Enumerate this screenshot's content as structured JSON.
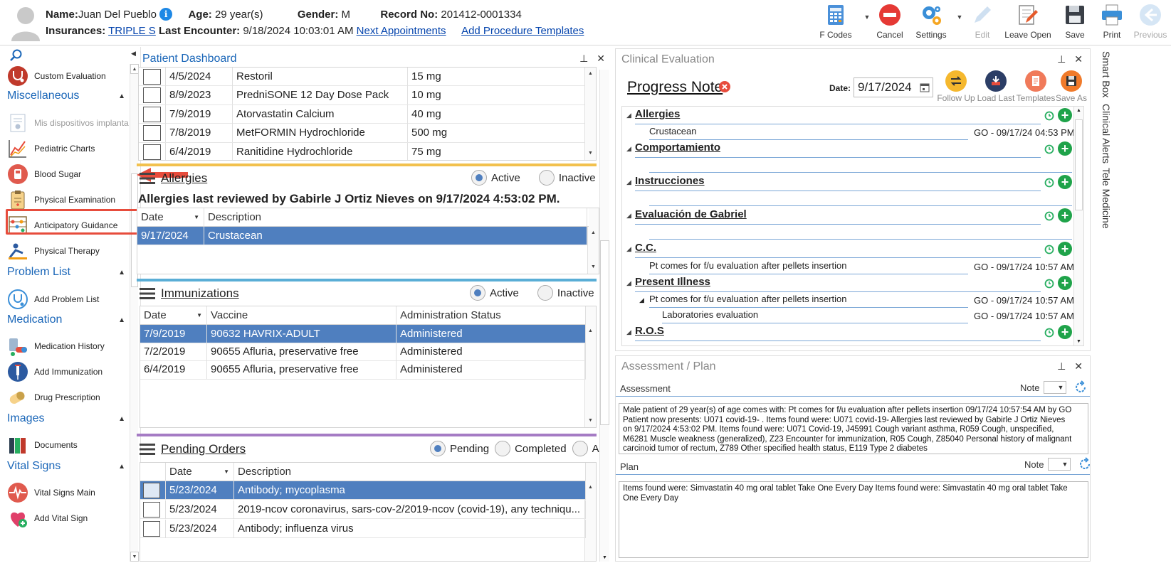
{
  "header": {
    "name_label": "Name:",
    "name": "Juan Del Pueblo",
    "age_label": "Age:",
    "age": "29 year(s)",
    "gender_label": "Gender:",
    "gender": "M",
    "record_label": "Record No:",
    "record": "201412-0001334",
    "insurances_label": "Insurances:",
    "insurance": "TRIPLE S",
    "last_encounter_label": "Last Encounter:",
    "last_encounter": "9/18/2024 10:03:01 AM",
    "next_appointments": "Next Appointments",
    "add_procedure_templates": "Add Procedure Templates",
    "info_glyph": "i"
  },
  "toolbar": {
    "f_codes": "F Codes",
    "cancel": "Cancel",
    "settings": "Settings",
    "edit": "Edit",
    "leave_open": "Leave Open",
    "save": "Save",
    "print": "Print",
    "previous": "Previous"
  },
  "sidebar": {
    "items": {
      "custom_evaluation": "Custom Evaluation",
      "implant_devices": "Mis dispositivos implanta",
      "pediatric_charts": "Pediatric Charts",
      "blood_sugar": "Blood Sugar",
      "physical_examination": "Physical Examination",
      "anticipatory_guidance": "Anticipatory Guidance",
      "physical_therapy": "Physical Therapy",
      "add_problem_list": "Add Problem List",
      "medication_history": "Medication History",
      "add_immunization": "Add Immunization",
      "drug_prescription": "Drug Prescription",
      "documents": "Documents",
      "vital_signs_main": "Vital Signs Main",
      "add_vital_sign": "Add Vital Sign"
    },
    "sections": {
      "miscellaneous": "Miscellaneous",
      "problem_list": "Problem List",
      "medication": "Medication",
      "images": "Images",
      "vital_signs": "Vital Signs"
    }
  },
  "dashboard": {
    "title": "Patient Dashboard",
    "medications": [
      {
        "date": "4/5/2024",
        "name": "Restoril",
        "dose": "15 mg"
      },
      {
        "date": "8/9/2023",
        "name": "PredniSONE 12 Day Dose Pack",
        "dose": "10 mg"
      },
      {
        "date": "7/9/2019",
        "name": "Atorvastatin Calcium",
        "dose": "40 mg"
      },
      {
        "date": "7/8/2019",
        "name": "MetFORMIN Hydrochloride",
        "dose": "500 mg"
      },
      {
        "date": "6/4/2019",
        "name": "Ranitidine Hydrochloride",
        "dose": "75 mg"
      }
    ],
    "allergies": {
      "title": "Allergies",
      "active": "Active",
      "inactive": "Inactive",
      "reviewed": "Allergies last reviewed by Gabirle J Ortiz Nieves on 9/17/2024 4:53:02 PM.",
      "col_date": "Date",
      "col_description": "Description",
      "rows": [
        {
          "date": "9/17/2024",
          "description": "Crustacean"
        }
      ]
    },
    "immunizations": {
      "title": "Immunizations",
      "active": "Active",
      "inactive": "Inactive",
      "col_date": "Date",
      "col_vaccine": "Vaccine",
      "col_status": "Administration Status",
      "rows": [
        {
          "date": "7/9/2019",
          "vaccine": "90632 HAVRIX-ADULT",
          "status": "Administered"
        },
        {
          "date": "7/2/2019",
          "vaccine": "90655 Afluria, preservative free",
          "status": "Administered"
        },
        {
          "date": "6/4/2019",
          "vaccine": "90655 Afluria, preservative free",
          "status": "Administered"
        }
      ]
    },
    "orders": {
      "title": "Pending Orders",
      "pending": "Pending",
      "completed": "Completed",
      "all": "All",
      "col_date": "Date",
      "col_description": "Description",
      "rows": [
        {
          "date": "5/23/2024",
          "description": "Antibody; mycoplasma"
        },
        {
          "date": "5/23/2024",
          "description": "2019-ncov coronavirus, sars-cov-2/2019-ncov (covid-19), any techniqu..."
        },
        {
          "date": "5/23/2024",
          "description": "Antibody; influenza virus"
        }
      ]
    }
  },
  "clinical": {
    "title": "Clinical Evaluation",
    "progress_note": "Progress Note",
    "date_label": "Date:",
    "date": "9/17/2024",
    "follow_up": "Follow Up",
    "load_last": "Load Last",
    "templates": "Templates",
    "save_as": "Save As",
    "sections": {
      "allergies": "Allergies",
      "comportamiento": "Comportamiento",
      "instrucciones": "Instrucciones",
      "evaluacion": "Evaluación de Gabriel",
      "cc": "C.C.",
      "present_illness": "Present Illness",
      "ros": "R.O.S"
    },
    "items": {
      "allergy_item": "Crustacean",
      "allergy_meta": "GO - 09/17/24 04:53 PM",
      "cc_item": "Pt comes for f/u evaluation after pellets insertion",
      "cc_meta": "GO - 09/17/24 10:57 AM",
      "pi_item": "Pt comes for f/u evaluation after pellets insertion",
      "pi_meta": "GO - 09/17/24 10:57 AM",
      "pi_sub": "Laboratories evaluation",
      "pi_sub_meta": "GO - 09/17/24 10:57 AM"
    }
  },
  "vtabs": {
    "smart_box": "Smart Box",
    "clinical_alerts": "Clinical Alerts",
    "tele_medicine": "Tele Medicine"
  },
  "assessment_plan": {
    "title": "Assessment / Plan",
    "assessment_label": "Assessment",
    "plan_label": "Plan",
    "note_label": "Note",
    "assessment_text": "Male patient of 29 year(s) of age comes with:    Pt comes for f/u evaluation after pellets insertion   09/17/24 10:57:54 AM by GO   Patient now presents:  U071 covid-19- . Items found were:  U071 covid-19-    Allergies last reviewed by Gabirle J Ortiz Nieves on 9/17/2024 4:53:02 PM.     Items found were:  U071 Covid-19, J45991 Cough variant asthma, R059 Cough, unspecified, M6281 Muscle weakness (generalized), Z23 Encounter for immunization, R05 Cough, Z85040 Personal history of malignant carcinoid tumor of rectum, Z789 Other specified health status, E119 Type 2 diabetes",
    "plan_text": "  Items found were:  Simvastatin 40 mg oral tablet Take One Every Day   Items found were:  Simvastatin 40 mg oral tablet Take One Every Day"
  },
  "colors": {
    "accent_blue": "#1a66b8",
    "selection": "#4f7fbf",
    "allergies_bar": "#f2c14e",
    "immunizations_bar": "#5aaed6",
    "orders_bar": "#a57bc4",
    "highlight_red": "#e74c3c"
  }
}
